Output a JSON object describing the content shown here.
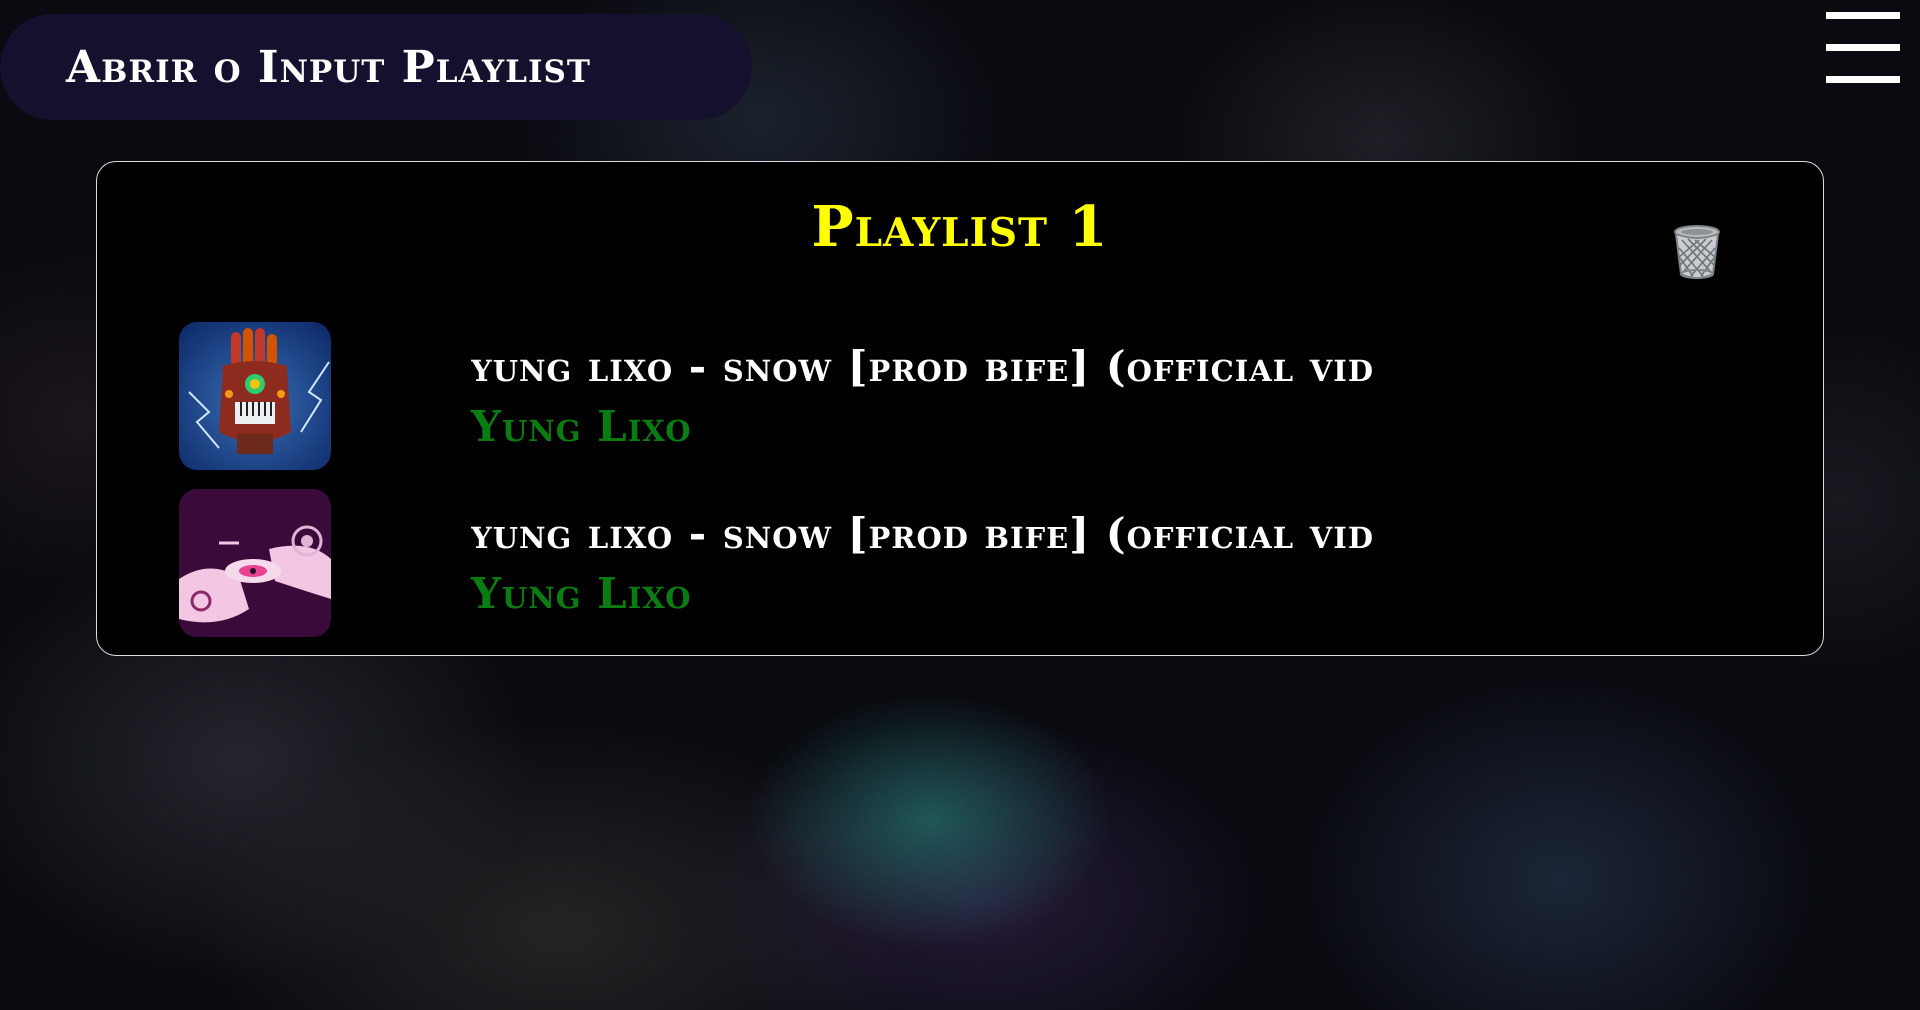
{
  "header": {
    "open_button_label": "Abrir o Input Playlist",
    "menu_icon": "hamburger-menu-icon"
  },
  "playlist": {
    "title": "Playlist 1",
    "delete_icon": "trash-can-icon",
    "tracks": [
      {
        "title": "YUNG LIXO - SNOW [PROD BIFE] (OFFICIAL VID",
        "artist": "Yung Lixo",
        "thumbnail_icon": "album-art-robot-hand"
      },
      {
        "title": "YUNG LIXO - SNOW [PROD BIFE] (OFFICIAL VID",
        "artist": "Yung Lixo",
        "thumbnail_icon": "album-art-pink-hands"
      }
    ]
  },
  "colors": {
    "playlist_title": "#ffff00",
    "artist": "#0a7d12",
    "button_bg": "#15102e",
    "card_bg": "#000000"
  }
}
